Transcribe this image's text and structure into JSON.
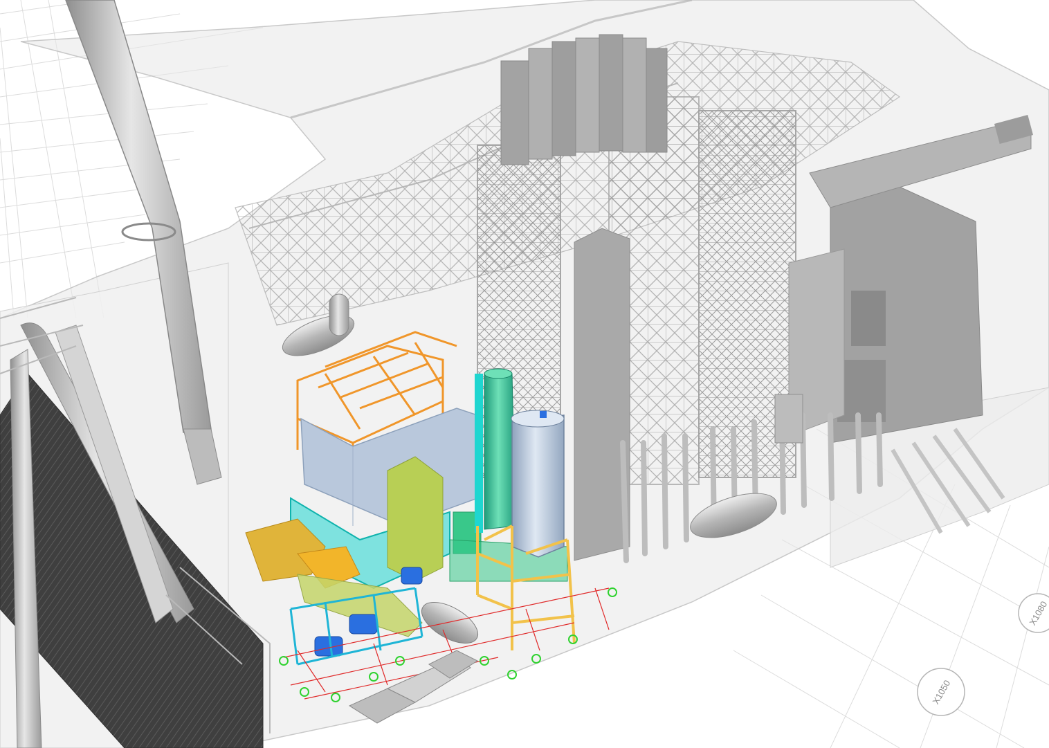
{
  "viewport": {
    "background": "#ffffff",
    "grid_color": "#d9d9d9",
    "ghost_color": "#bdbdbd",
    "highlight_colors": {
      "orange": "#f0962a",
      "cyan": "#1fd6d0",
      "green": "#39c88a",
      "yellow_green": "#b8cf55",
      "blue": "#2a6fe0",
      "gold": "#f2b52a",
      "pale_blue": "#b9c8dc",
      "red_grid": "#e02a2a",
      "green_marker": "#2fd22f"
    }
  },
  "grid_markers": [
    {
      "label": "X1050"
    },
    {
      "label": "X1080"
    }
  ]
}
